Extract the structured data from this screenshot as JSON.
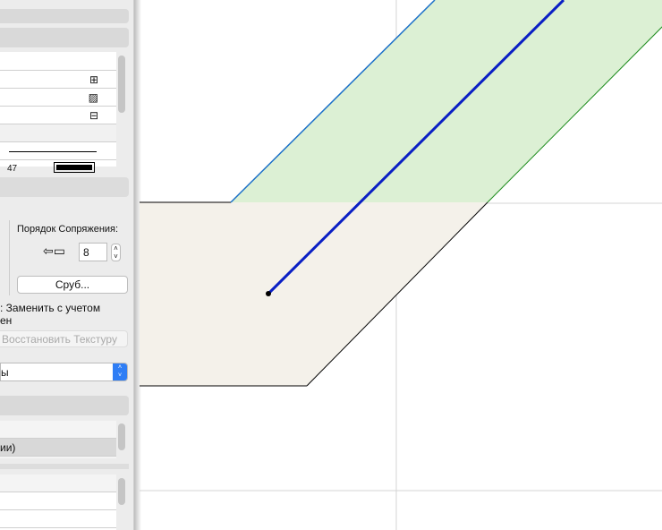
{
  "panel": {
    "list1_icons": [
      "wall-layer-icon",
      "slab-layer-icon",
      "wall-cut-icon"
    ],
    "truncated_value": "47",
    "junction_order_label": "Порядок Сопряжения:",
    "junction_order_value": "8",
    "log_button": "Сруб...",
    "replace_text": ": Заменить с учетом",
    "replace_text2": "ен",
    "restore_texture_button": "Восстановить Текстуру",
    "select_value": "ы",
    "list2_item": "ии)"
  },
  "colors": {
    "accent": "#2f7ef5",
    "beige": "#f4f1ea",
    "green": "#dcf0d4",
    "blue": "#0a1fc4"
  }
}
